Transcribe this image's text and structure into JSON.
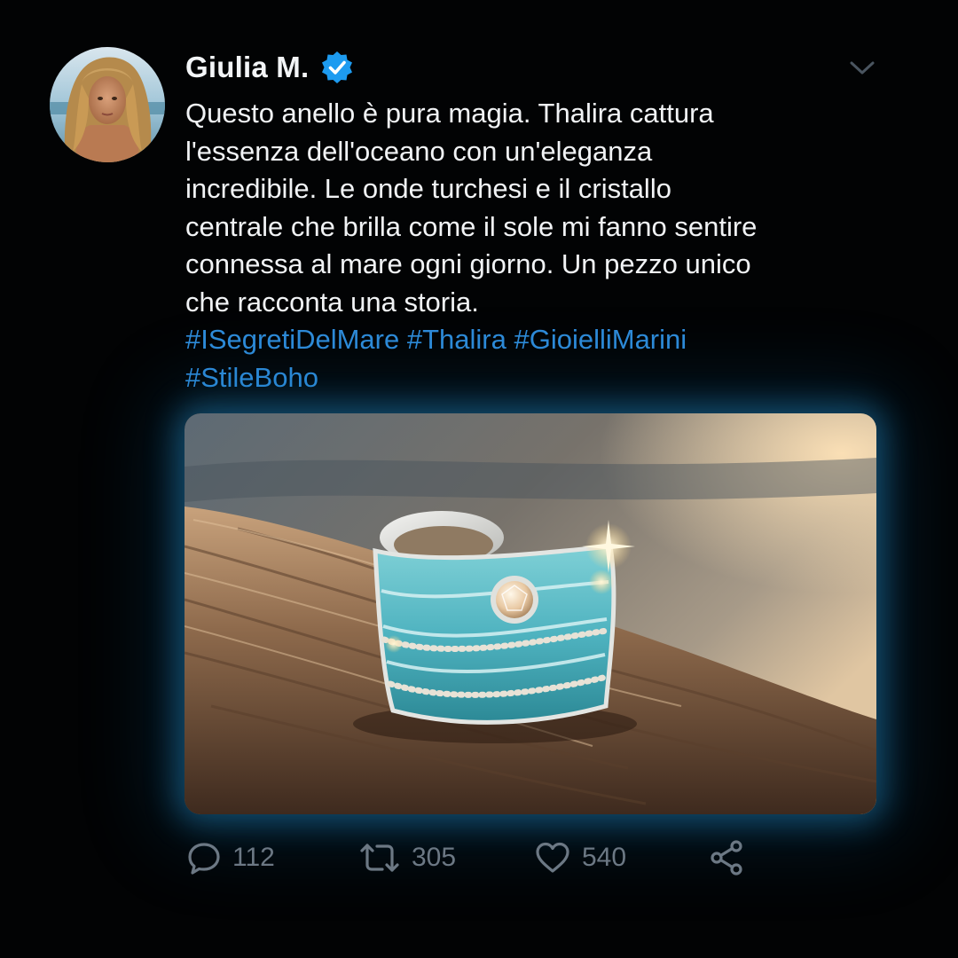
{
  "post": {
    "author": {
      "name": "Giulia M.",
      "verified": true,
      "avatar": "profile-photo"
    },
    "text_lines": [
      "Questo anello è pura magia. Thalira cattura",
      "l'essenza dell'oceano con un'eleganza",
      "incredibile. Le onde turchesi e il cristallo",
      "centrale che brilla come il sole mi fanno sentire",
      "connessa al mare ogni giorno. Un pezzo unico",
      "che racconta una storia."
    ],
    "hashtags": [
      "#ISegretiDelMare",
      "#Thalira",
      "#GioielliMarini",
      "#StileBoho"
    ],
    "media": {
      "icon": "ring-photo"
    },
    "actions": {
      "replies": "112",
      "retweets": "305",
      "likes": "540"
    }
  },
  "colors": {
    "background": "#020304",
    "hashtag": "#2e8bd9",
    "verified": "#1d9bf0",
    "icon_muted": "#6c7884",
    "glow": "#2391cd"
  },
  "icons": [
    "chevron-down-icon",
    "verified-badge-icon",
    "reply-icon",
    "retweet-icon",
    "heart-icon",
    "share-icon"
  ]
}
